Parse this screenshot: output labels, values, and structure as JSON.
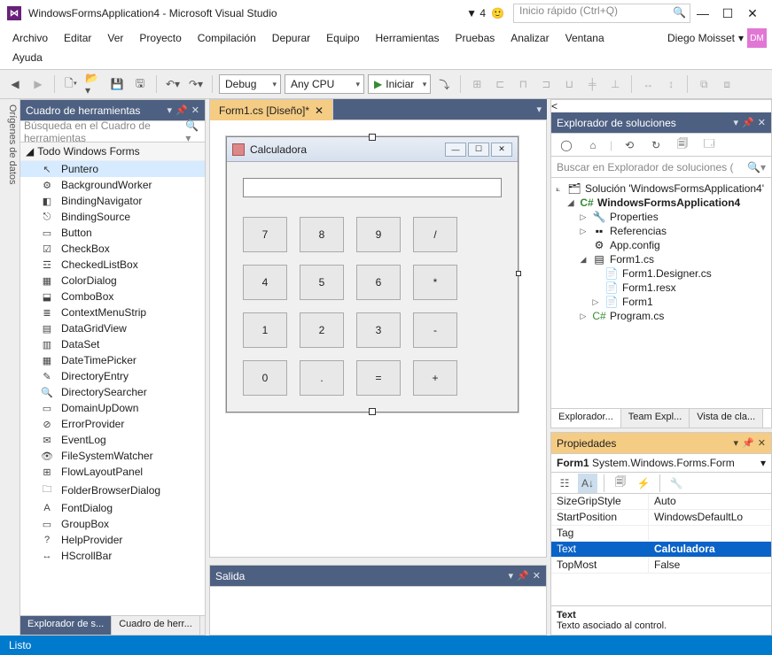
{
  "title": "WindowsFormsApplication4 - Microsoft Visual Studio",
  "notifications": "4",
  "quicklaunch_placeholder": "Inicio rápido (Ctrl+Q)",
  "menu": [
    "Archivo",
    "Editar",
    "Ver",
    "Proyecto",
    "Compilación",
    "Depurar",
    "Equipo",
    "Herramientas",
    "Pruebas",
    "Analizar",
    "Ventana"
  ],
  "menu2": [
    "Ayuda"
  ],
  "user": {
    "name": "Diego Moisset",
    "initials": "DM"
  },
  "toolbar": {
    "config": "Debug",
    "platform": "Any CPU",
    "start": "Iniciar"
  },
  "leftstrip": "Orígenes de datos",
  "toolbox": {
    "title": "Cuadro de herramientas",
    "search_placeholder": "Búsqueda en el Cuadro de herramientas",
    "category": "Todo Windows Forms",
    "items": [
      {
        "icon": "↖",
        "label": "Puntero",
        "sel": true
      },
      {
        "icon": "⚙",
        "label": "BackgroundWorker"
      },
      {
        "icon": "◧",
        "label": "BindingNavigator"
      },
      {
        "icon": "⎋",
        "label": "BindingSource"
      },
      {
        "icon": "▭",
        "label": "Button"
      },
      {
        "icon": "☑",
        "label": "CheckBox"
      },
      {
        "icon": "☲",
        "label": "CheckedListBox"
      },
      {
        "icon": "▦",
        "label": "ColorDialog"
      },
      {
        "icon": "⬓",
        "label": "ComboBox"
      },
      {
        "icon": "≣",
        "label": "ContextMenuStrip"
      },
      {
        "icon": "▤",
        "label": "DataGridView"
      },
      {
        "icon": "▥",
        "label": "DataSet"
      },
      {
        "icon": "▦",
        "label": "DateTimePicker"
      },
      {
        "icon": "✎",
        "label": "DirectoryEntry"
      },
      {
        "icon": "🔍",
        "label": "DirectorySearcher"
      },
      {
        "icon": "▭",
        "label": "DomainUpDown"
      },
      {
        "icon": "⊘",
        "label": "ErrorProvider"
      },
      {
        "icon": "✉",
        "label": "EventLog"
      },
      {
        "icon": "👁",
        "label": "FileSystemWatcher"
      },
      {
        "icon": "⊞",
        "label": "FlowLayoutPanel"
      },
      {
        "icon": "🗀",
        "label": "FolderBrowserDialog"
      },
      {
        "icon": "A",
        "label": "FontDialog"
      },
      {
        "icon": "▭",
        "label": "GroupBox"
      },
      {
        "icon": "?",
        "label": "HelpProvider"
      },
      {
        "icon": "↔",
        "label": "HScrollBar"
      }
    ],
    "bottom_tabs": [
      "Explorador de s...",
      "Cuadro de herr..."
    ],
    "bottom_active": 0
  },
  "doc": {
    "tab": "Form1.cs [Diseño]*",
    "form_title": "Calculadora",
    "calc_buttons": [
      "7",
      "8",
      "9",
      "/",
      "4",
      "5",
      "6",
      "*",
      "1",
      "2",
      "3",
      "-",
      "0",
      ".",
      "=",
      "+"
    ]
  },
  "output": {
    "title": "Salida"
  },
  "solution": {
    "title": "Explorador de soluciones",
    "search_placeholder": "Buscar en Explorador de soluciones (",
    "root": "Solución 'WindowsFormsApplication4'",
    "project": "WindowsFormsApplication4",
    "nodes": {
      "properties": "Properties",
      "references": "Referencias",
      "appconfig": "App.config",
      "form1": "Form1.cs",
      "form1designer": "Form1.Designer.cs",
      "form1resx": "Form1.resx",
      "form1node": "Form1",
      "program": "Program.cs"
    },
    "tabs": [
      "Explorador...",
      "Team Expl...",
      "Vista de cla..."
    ],
    "tabs_active": 0
  },
  "properties": {
    "title": "Propiedades",
    "object": "Form1",
    "object_type": "System.Windows.Forms.Form",
    "rows": [
      {
        "name": "SizeGripStyle",
        "value": "Auto"
      },
      {
        "name": "StartPosition",
        "value": "WindowsDefaultLo"
      },
      {
        "name": "Tag",
        "value": ""
      },
      {
        "name": "Text",
        "value": "Calculadora",
        "sel": true
      },
      {
        "name": "TopMost",
        "value": "False"
      }
    ],
    "desc_name": "Text",
    "desc_text": "Texto asociado al control."
  },
  "status": "Listo"
}
